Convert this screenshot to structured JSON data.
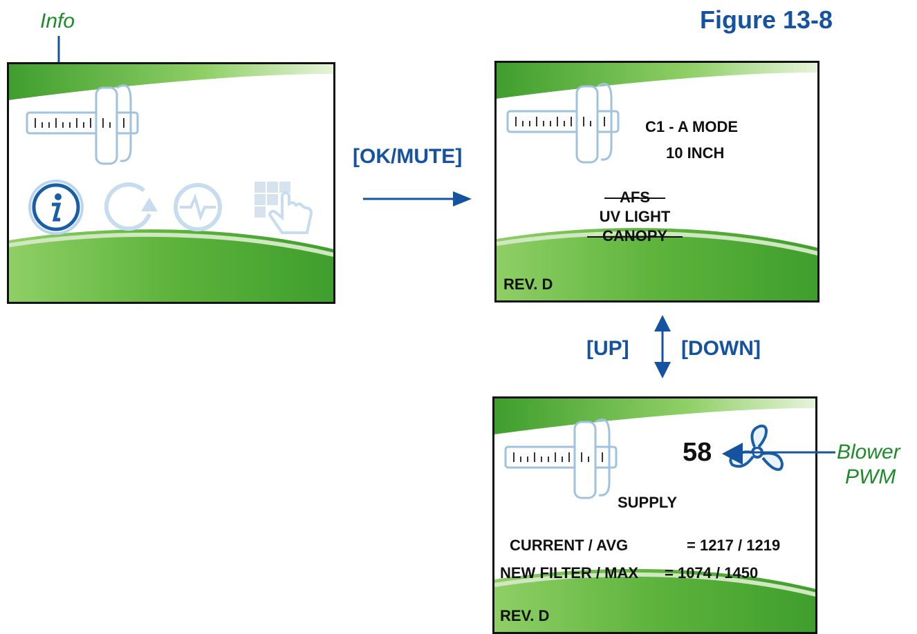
{
  "figure_label": "Figure 13-8",
  "callouts": {
    "info": "Info",
    "blower_line1": "Blower",
    "blower_line2": "PWM"
  },
  "transitions": {
    "ok_mute": "[OK/MUTE]",
    "up": "[UP]",
    "down": "[DOWN]"
  },
  "screen_menu": {
    "icons": [
      "info-icon",
      "refresh-icon",
      "heartbeat-icon",
      "touch-grid-icon"
    ]
  },
  "screen_info": {
    "mode": "C1 - A MODE",
    "size": "10 INCH",
    "option_afs": "AFS",
    "option_uv": "UV LIGHT",
    "option_canopy": "CANOPY",
    "revision": "REV. D"
  },
  "screen_supply": {
    "pwm_value": "58",
    "title": "SUPPLY",
    "current_avg_label": "CURRENT / AVG",
    "current_avg_value": "= 1217 / 1219",
    "new_filter_label": "NEW FILTER / MAX",
    "new_filter_value": "= 1074 / 1450",
    "revision": "REV. D"
  },
  "colors": {
    "blue": "#1553a0",
    "green": "#1f8a2a",
    "screen_green": "#58b33a"
  }
}
